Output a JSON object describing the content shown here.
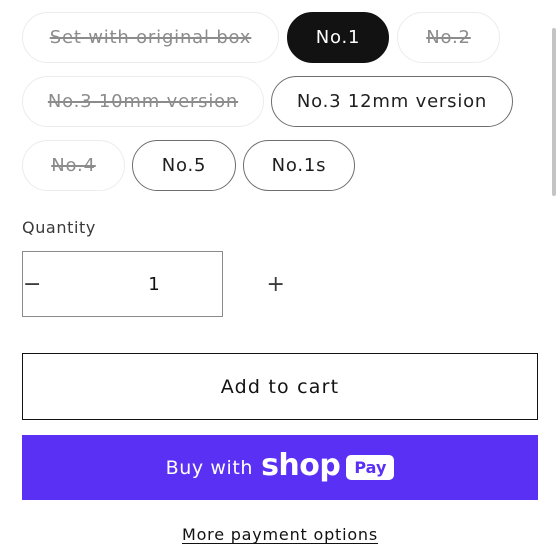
{
  "variants": [
    {
      "label": "Set with original box",
      "state": "unavailable"
    },
    {
      "label": "No.1",
      "state": "selected"
    },
    {
      "label": "No.2",
      "state": "unavailable"
    },
    {
      "label": "No.3 10mm version",
      "state": "unavailable"
    },
    {
      "label": "No.3 12mm version",
      "state": "available"
    },
    {
      "label": "No.4",
      "state": "unavailable"
    },
    {
      "label": "No.5",
      "state": "available"
    },
    {
      "label": "No.1s",
      "state": "available"
    }
  ],
  "quantity": {
    "label": "Quantity",
    "value": "1",
    "decrease_symbol": "−",
    "increase_symbol": "+"
  },
  "actions": {
    "add_to_cart": "Add to cart",
    "shop_pay_prefix": "Buy with",
    "shop_pay_brand": "shop",
    "shop_pay_badge": "Pay",
    "more_payment_options": "More payment options"
  },
  "colors": {
    "shop_pay_bg": "#5a31f4",
    "selected_bg": "#121212"
  }
}
